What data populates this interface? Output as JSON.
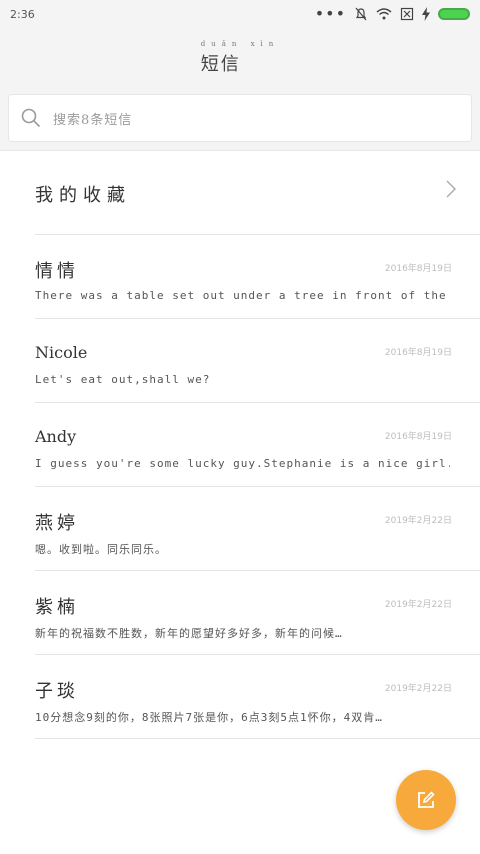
{
  "status_bar": {
    "time": "2:36"
  },
  "app_bar": {
    "pinyin": "duǎn xìn",
    "title": "短信"
  },
  "search": {
    "placeholder": "搜索8条短信"
  },
  "favorites": {
    "label": "我的收藏"
  },
  "conversations": [
    {
      "name": "情情",
      "date": "2016年8月19日",
      "preview": "There was a table set out under a tree in front of the hous"
    },
    {
      "name": "Nicole",
      "date": "2016年8月19日",
      "preview": "Let's eat out,shall we?"
    },
    {
      "name": "Andy",
      "date": "2016年8月19日",
      "preview": "I guess you're some lucky guy.Stephanie is a nice girl."
    },
    {
      "name": "燕婷",
      "date": "2019年2月22日",
      "preview": "嗯。收到啦。同乐同乐。"
    },
    {
      "name": "紫楠",
      "date": "2019年2月22日",
      "preview": "新年的祝福数不胜数，新年的愿望好多好多，新年的问候…"
    },
    {
      "name": "子琰",
      "date": "2019年2月22日",
      "preview": "10分想念9刻的你，8张照片7张是你，6点3刻5点1怀你，4双肯…"
    }
  ]
}
